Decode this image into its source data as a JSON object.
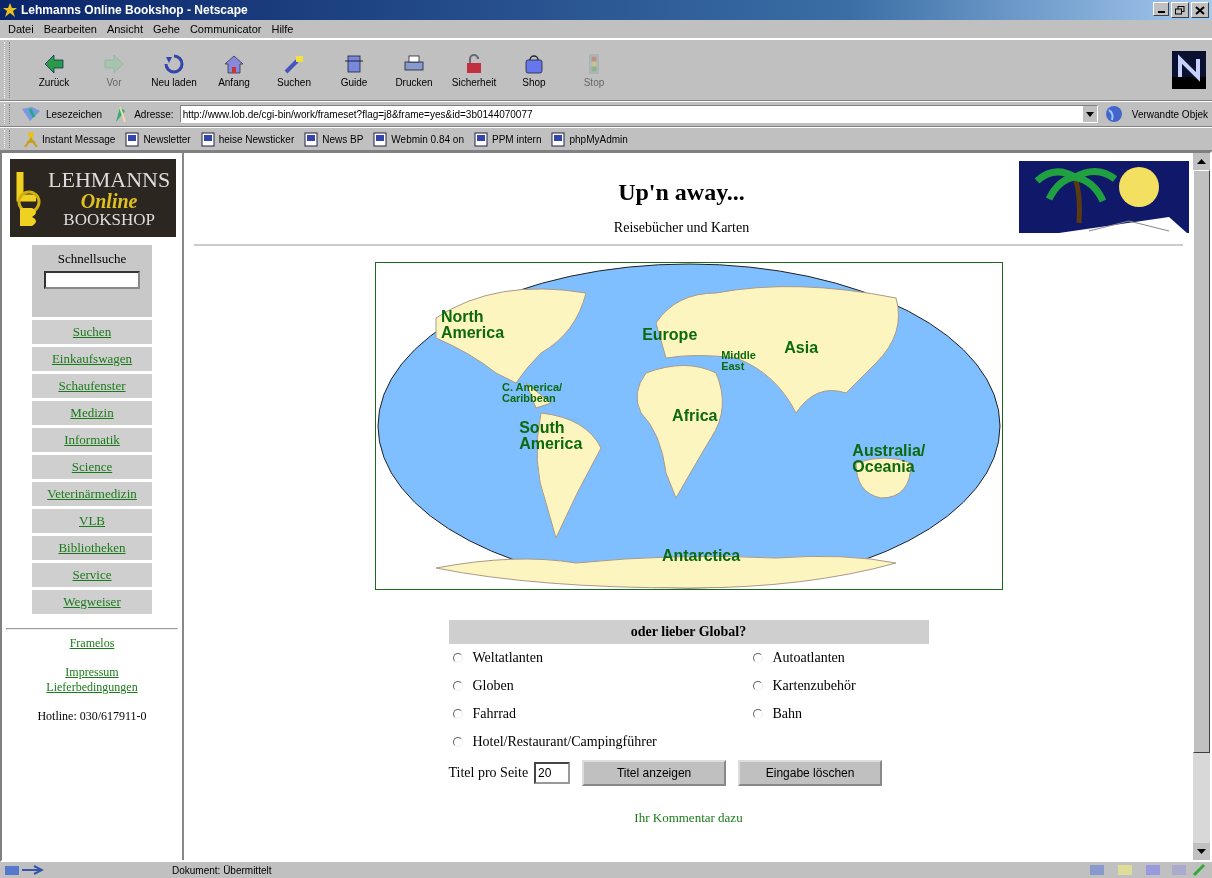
{
  "window": {
    "title": "Lehmanns Online Bookshop - Netscape"
  },
  "menu": [
    "Datei",
    "Bearbeiten",
    "Ansicht",
    "Gehe",
    "Communicator",
    "Hilfe"
  ],
  "toolbar": [
    {
      "label": "Zurück",
      "kind": "back",
      "disabled": false
    },
    {
      "label": "Vor",
      "kind": "forward",
      "disabled": true
    },
    {
      "label": "Neu laden",
      "kind": "reload",
      "disabled": false
    },
    {
      "label": "Anfang",
      "kind": "home",
      "disabled": false
    },
    {
      "label": "Suchen",
      "kind": "search",
      "disabled": false
    },
    {
      "label": "Guide",
      "kind": "guide",
      "disabled": false
    },
    {
      "label": "Drucken",
      "kind": "print",
      "disabled": false
    },
    {
      "label": "Sicherheit",
      "kind": "security",
      "disabled": false
    },
    {
      "label": "Shop",
      "kind": "shop",
      "disabled": false
    },
    {
      "label": "Stop",
      "kind": "stop",
      "disabled": true
    }
  ],
  "location": {
    "bookmarks": "Lesezeichen",
    "label": "Adresse:",
    "url": "http://www.lob.de/cgi-bin/work/frameset?flag=j8&frame=yes&id=3b0144070077",
    "related": "Verwandte Objek"
  },
  "personal_bar": [
    {
      "label": "Instant Message",
      "kind": "person"
    },
    {
      "label": "Newsletter",
      "kind": "page"
    },
    {
      "label": "heise Newsticker",
      "kind": "page"
    },
    {
      "label": "News BP",
      "kind": "page"
    },
    {
      "label": "Webmin 0.84 on",
      "kind": "page"
    },
    {
      "label": "PPM intern",
      "kind": "page"
    },
    {
      "label": "phpMyAdmin",
      "kind": "page"
    }
  ],
  "sidebar": {
    "logo": {
      "line1": "LEHMANNS",
      "line2": "Online",
      "line3": "BOOKSHOP"
    },
    "quicksearch": {
      "label": "Schnellsuche"
    },
    "items": [
      "Suchen",
      "Einkaufswagen",
      "Schaufenster",
      "Medizin",
      "Informatik",
      "Science",
      "Veterinärmedizin",
      "VLB",
      "Bibliotheken",
      "Service",
      "Wegweiser"
    ],
    "link_groups": [
      [
        "Framelos"
      ],
      [
        "Impressum",
        "Lieferbedingungen"
      ]
    ],
    "hotline": "Hotline: 030/617911-0"
  },
  "page": {
    "title": "Up'n away...",
    "subtitle": "Reisebücher und Karten",
    "map_labels": [
      "North\nAmerica",
      "Europe",
      "Middle\nEast",
      "Asia",
      "C. America/\nCaribbean",
      "Africa",
      "South\nAmerica",
      "Australia/\nOceania",
      "Antarctica"
    ],
    "form": {
      "heading": "oder lieber Global?",
      "options": [
        {
          "label": "Weltatlanten",
          "selected": false
        },
        {
          "label": "Autoatlanten",
          "selected": false
        },
        {
          "label": "Globen",
          "selected": false
        },
        {
          "label": "Kartenzubehör",
          "selected": false
        },
        {
          "label": "Fahrrad",
          "selected": false
        },
        {
          "label": "Bahn",
          "selected": false
        },
        {
          "label": "Hotel/Restaurant/Campingführer",
          "selected": false
        }
      ],
      "per_page_label": "Titel pro Seite",
      "per_page": "20",
      "buttons": [
        "Titel anzeigen",
        "Eingabe löschen"
      ]
    },
    "comment_link": "Ihr Kommentar dazu"
  },
  "status_bar": {
    "text": "Dokument: Übermittelt"
  }
}
